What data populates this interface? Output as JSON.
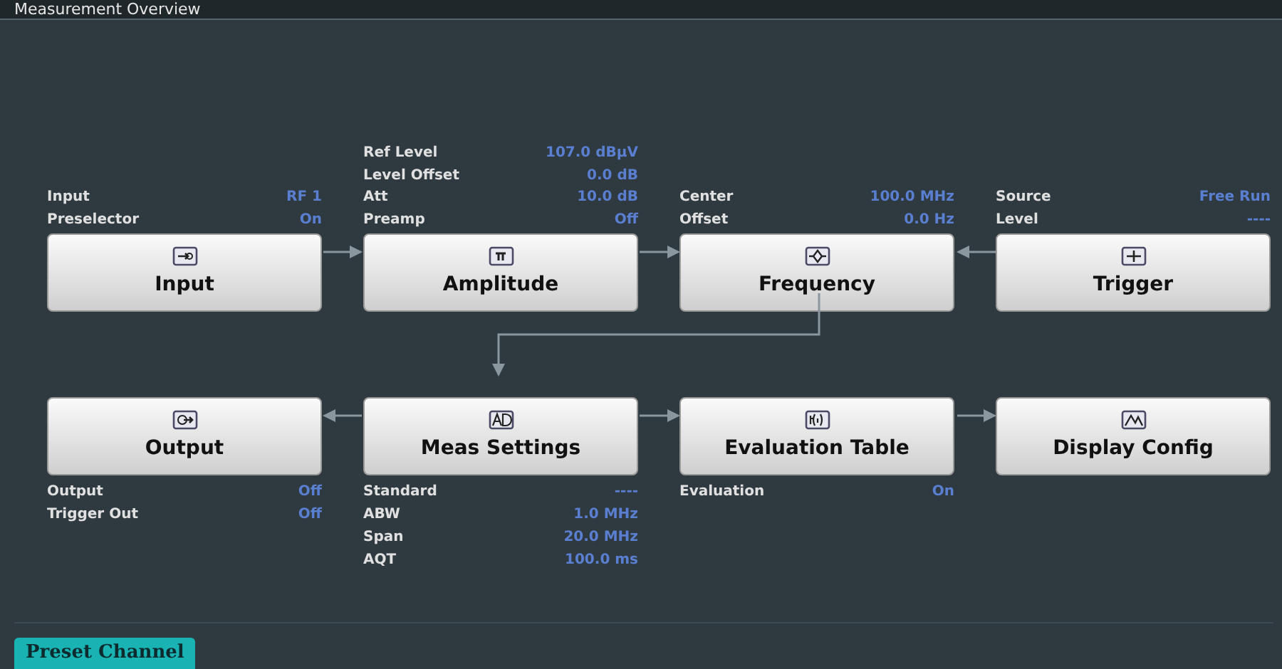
{
  "window": {
    "title": "Measurement Overview"
  },
  "top_row": [
    {
      "label": "Input",
      "params": [
        {
          "label": "Input",
          "value": "RF 1"
        },
        {
          "label": "Preselector",
          "value": "On"
        }
      ]
    },
    {
      "label": "Amplitude",
      "params": [
        {
          "label": "Ref Level",
          "value": "107.0 dBµV"
        },
        {
          "label": "Level Offset",
          "value": "0.0 dB"
        },
        {
          "label": "Att",
          "value": "10.0 dB"
        },
        {
          "label": "Preamp",
          "value": "Off"
        }
      ]
    },
    {
      "label": "Frequency",
      "params": [
        {
          "label": "Center",
          "value": "100.0 MHz"
        },
        {
          "label": "Offset",
          "value": "0.0 Hz"
        }
      ]
    },
    {
      "label": "Trigger",
      "params": [
        {
          "label": "Source",
          "value": "Free Run"
        },
        {
          "label": "Level",
          "value": "----"
        }
      ]
    }
  ],
  "bottom_row": [
    {
      "label": "Output",
      "params": [
        {
          "label": "Output",
          "value": "Off"
        },
        {
          "label": "Trigger Out",
          "value": "Off"
        }
      ]
    },
    {
      "label": "Meas Settings",
      "params": [
        {
          "label": "Standard",
          "value": "----"
        },
        {
          "label": "ABW",
          "value": "1.0 MHz"
        },
        {
          "label": "Span",
          "value": "20.0 MHz"
        },
        {
          "label": "AQT",
          "value": "100.0 ms"
        }
      ]
    },
    {
      "label": "Evaluation Table",
      "params": [
        {
          "label": "Evaluation",
          "value": "On"
        }
      ]
    },
    {
      "label": "Display Config"
    }
  ],
  "preset_button": "Preset Channel"
}
